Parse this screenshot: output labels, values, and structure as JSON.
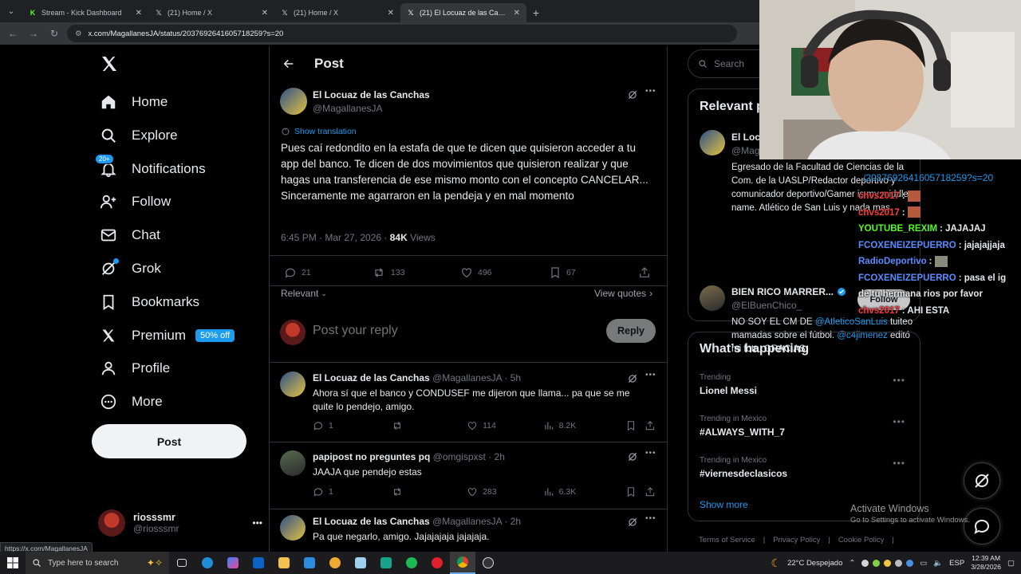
{
  "browser": {
    "tabs": [
      {
        "label": "Stream - Kick Dashboard",
        "active": false
      },
      {
        "label": "(21) Home / X",
        "active": false
      },
      {
        "label": "(21) Home / X",
        "active": false
      },
      {
        "label": "(21) El Locuaz de las Canchas on X",
        "active": true
      }
    ],
    "url": "x.com/MagallanesJA/status/2037692641605718259?s=20",
    "status_url": "https://x.com/MagallanesJA"
  },
  "nav": {
    "items": [
      {
        "label": "Home",
        "icon": "home-icon"
      },
      {
        "label": "Explore",
        "icon": "search-icon"
      },
      {
        "label": "Notifications",
        "icon": "bell-icon",
        "badge": "20+"
      },
      {
        "label": "Follow",
        "icon": "person-add-icon"
      },
      {
        "label": "Chat",
        "icon": "mail-icon"
      },
      {
        "label": "Grok",
        "icon": "grok-icon"
      },
      {
        "label": "Bookmarks",
        "icon": "bookmark-icon"
      },
      {
        "label": "Premium",
        "icon": "x-logo-icon",
        "tag": "50% off"
      },
      {
        "label": "Profile",
        "icon": "person-icon"
      },
      {
        "label": "More",
        "icon": "more-circle-icon"
      }
    ],
    "post_button": "Post",
    "account": {
      "name": "riosssmr",
      "handle": "@riosssmr"
    }
  },
  "main": {
    "header_title": "Post",
    "tweet": {
      "name": "El Locuaz de las Canchas",
      "handle": "@MagallanesJA",
      "show_translation": "Show translation",
      "text": "Pues caí redondito en la estafa de que te dicen que quisieron acceder a tu app del banco. Te dicen de dos movimientos que quisieron realizar y que hagas una transferencia de ese mismo monto con el concepto CANCELAR... Sinceramente me agarraron en la pendeja y en mal momento",
      "time": "6:45 PM · Mar 27, 2026 · ",
      "views_count": "84K",
      "views_label": " Views",
      "replies": "21",
      "reposts": "133",
      "likes": "496",
      "bookmarks": "67",
      "sort_label": "Relevant",
      "view_quotes": "View quotes"
    },
    "reply_box": {
      "placeholder": "Post your reply",
      "button": "Reply"
    },
    "replies": [
      {
        "name": "El Locuaz de las Canchas",
        "handle": "@MagallanesJA",
        "time": "· 5h",
        "text": "Ahora sí que el banco y CONDUSEF me dijeron que llama... pa que se me quite lo pendejo, amigo.",
        "replies": "1",
        "reposts": "",
        "likes": "114",
        "views": "8.2K"
      },
      {
        "name": "papipost no preguntes pq",
        "handle": "@omgispxst",
        "time": "· 2h",
        "text": "JAAJA que pendejo estas",
        "replies": "1",
        "reposts": "",
        "likes": "283",
        "views": "6.3K"
      },
      {
        "name": "El Locuaz de las Canchas",
        "handle": "@MagallanesJA",
        "time": "· 2h",
        "text": "Pa que negarlo, amigo. Jajajajaja jajajaja."
      }
    ]
  },
  "right": {
    "search_placeholder": "Search",
    "relevant": {
      "title": "Relevant people",
      "people": [
        {
          "name": "El Locuaz de las Canchas",
          "handle": "@MagallanesJA",
          "bio": "Egresado de la Facultad de Ciencias de la Com. de la UASLP/Redactor deportivo y comunicador deportivo/Gamer is my middle name. Atlético de San Luis y nada mas."
        },
        {
          "name": "BIEN RICO MARRER...",
          "handle": "@ElBuenChico_",
          "follow": "Follow",
          "bio_pre": "NO SOY EL CM DE ",
          "bio_link1": "@AtleticoSanLuis",
          "bio_mid": " tuiteo mamadas sobre el fútbol. ",
          "bio_link2": "@c4jimenez",
          "bio_post": " editó mi foto, GRACIAS."
        }
      ]
    },
    "happening": {
      "title": "What’s happening",
      "trends": [
        {
          "category": "Trending",
          "title": "Lionel Messi"
        },
        {
          "category": "Trending in Mexico",
          "title": "#ALWAYS_WITH_7"
        },
        {
          "category": "Trending in Mexico",
          "title": "#viernesdeclasicos"
        }
      ],
      "show_more": "Show more"
    },
    "footer": [
      "Terms of Service",
      "|",
      "Privacy Policy",
      "|",
      "Cookie Policy",
      "|"
    ]
  },
  "overlay": {
    "url_fragment": "/2037692641605718259?s=20",
    "chat": [
      {
        "user": "chvs2017",
        "msg": ":",
        "color": "#ff3b3b",
        "emote": true
      },
      {
        "user": "chvs2017",
        "msg": ":",
        "color": "#ff3b3b",
        "emote": true
      },
      {
        "user": "YOUTUBE_REXIM",
        "msg": ": JAJAJAJ",
        "color": "#53fc18"
      },
      {
        "user": "FCOXENEIZEPUERRO",
        "msg": ": jajajajjaja",
        "color": "#5b8cff"
      },
      {
        "user": "RadioDeportivo",
        "msg": ":",
        "color": "#5b8cff",
        "emote": true
      },
      {
        "user": "FCOXENEIZEPUERRO",
        "msg": ": pasa el ig",
        "color": "#5b8cff"
      },
      {
        "user": "",
        "msg": "de tu hermana rios por favor",
        "color": "#ffffff"
      },
      {
        "user": "chvs2017",
        "msg": ": AHI ESTA",
        "color": "#ff3b3b"
      }
    ],
    "activate_title": "Activate Windows",
    "activate_sub": "Go to Settings to activate Windows."
  },
  "taskbar": {
    "search_placeholder": "Type here to search",
    "weather": "22°C  Despejado",
    "lang": "ESP",
    "time": "12:39 AM",
    "date": "3/28/2026"
  },
  "colors": {
    "accent": "#1d9bf0",
    "background": "#000000",
    "border": "#2f3336",
    "kick_green": "#53fc18"
  }
}
